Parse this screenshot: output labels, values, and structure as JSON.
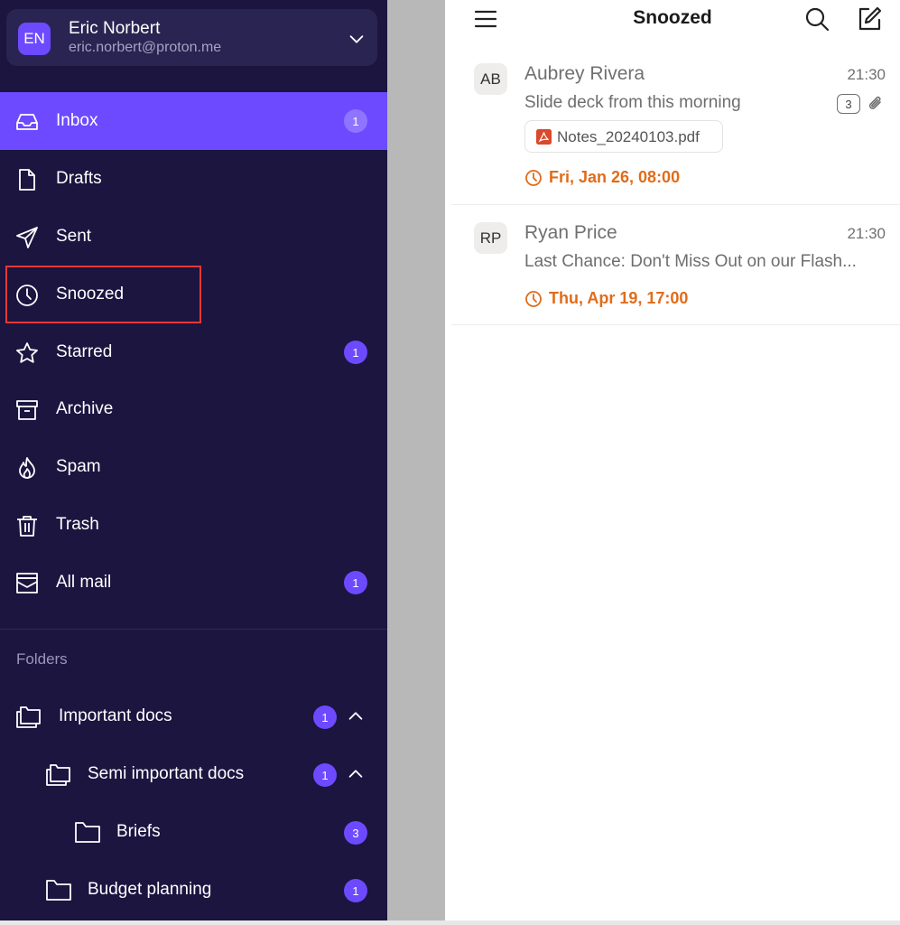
{
  "account": {
    "initials": "EN",
    "name": "Eric Norbert",
    "email": "eric.norbert@proton.me",
    "chevron_icon": "chevron-down-icon"
  },
  "nav": [
    {
      "label": "Inbox",
      "icon": "inbox-icon",
      "badge": "1",
      "active": true
    },
    {
      "label": "Drafts",
      "icon": "file-icon",
      "badge": null
    },
    {
      "label": "Sent",
      "icon": "paper-plane-icon",
      "badge": null
    },
    {
      "label": "Snoozed",
      "icon": "clock-icon",
      "badge": null,
      "highlighted": true
    },
    {
      "label": "Starred",
      "icon": "star-icon",
      "badge": "1"
    },
    {
      "label": "Archive",
      "icon": "archive-box-icon",
      "badge": null
    },
    {
      "label": "Spam",
      "icon": "fire-icon",
      "badge": null
    },
    {
      "label": "Trash",
      "icon": "trash-icon",
      "badge": null
    },
    {
      "label": "All mail",
      "icon": "all-mail-icon",
      "badge": "1"
    }
  ],
  "folders": {
    "heading": "Folders",
    "items": [
      {
        "label": "Important docs",
        "badge": "1",
        "expanded": true,
        "icon": "folders-icon"
      },
      {
        "label": "Semi important docs",
        "badge": "1",
        "expanded": true,
        "icon": "folders-icon"
      },
      {
        "label": "Briefs",
        "badge": "3",
        "icon": "folder-icon"
      },
      {
        "label": "Budget planning",
        "badge": "1",
        "icon": "folder-icon"
      }
    ]
  },
  "header": {
    "title": "Snoozed",
    "menu_icon": "hamburger-menu-icon",
    "search_icon": "search-icon",
    "compose_icon": "compose-icon"
  },
  "messages": [
    {
      "initials": "AB",
      "sender": "Aubrey Rivera",
      "time": "21:30",
      "subject": "Slide deck from this morning",
      "count": "3",
      "has_attachment": true,
      "attachment_name": "Notes_20240103.pdf",
      "snooze_until": "Fri, Jan 26, 08:00"
    },
    {
      "initials": "RP",
      "sender": "Ryan Price",
      "time": "21:30",
      "subject": "Last Chance: Don't Miss Out on our Flash...",
      "snooze_until": "Thu, Apr 19, 17:00"
    }
  ],
  "colors": {
    "sidebar_bg": "#1b1540",
    "accent": "#6d4aff",
    "snooze_orange": "#e06c1a",
    "highlight_red": "#e53935"
  }
}
